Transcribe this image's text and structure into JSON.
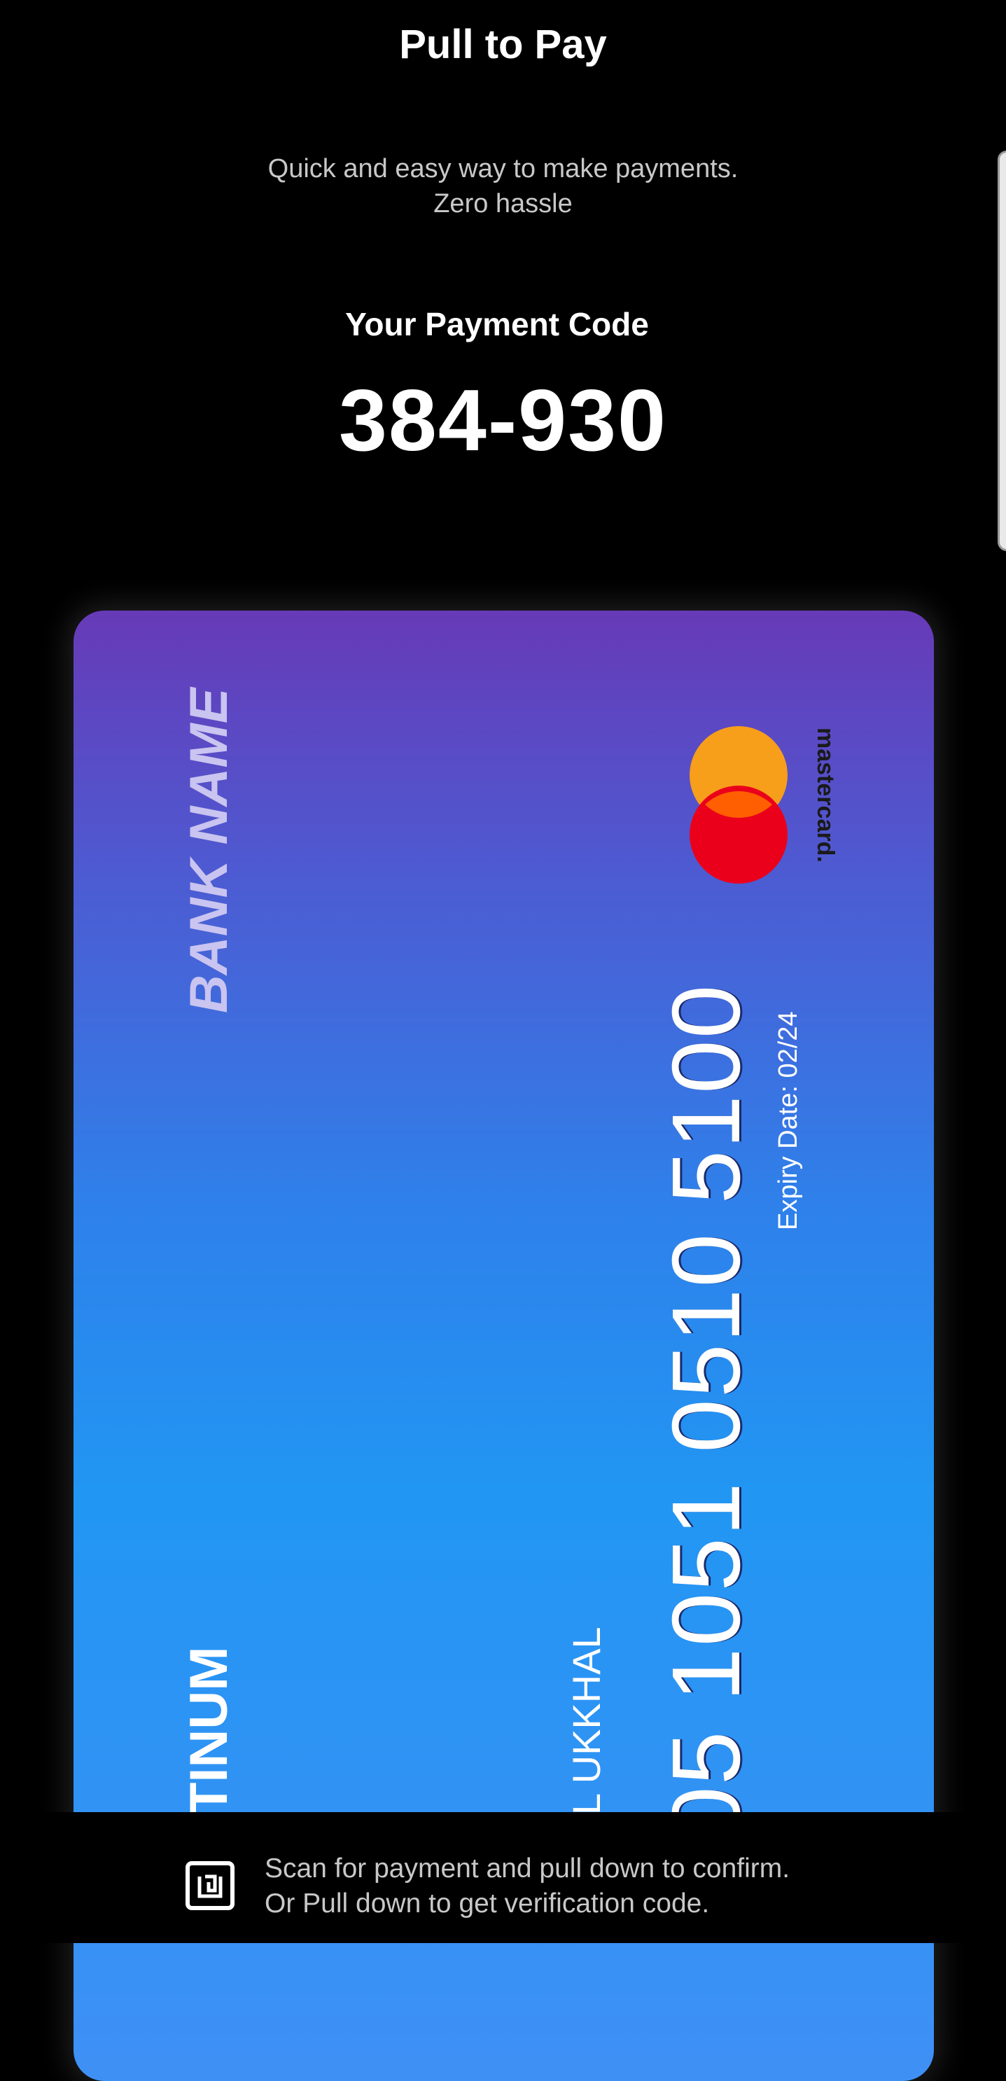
{
  "header": {
    "title": "Pull to Pay",
    "subtitle_line1": "Quick and easy way to make payments.",
    "subtitle_line2": "Zero hassle"
  },
  "payment_code": {
    "label": "Your Payment Code",
    "value": "384-930"
  },
  "card": {
    "bank_name": "BANK NAME",
    "tier": "TINUM",
    "holder": "L UKKHAL",
    "number": "05 1051 0510 5100",
    "expiry": "Expiry Date: 02/24",
    "network": "mastercard.",
    "gradient_top": "#673ab7",
    "gradient_bottom": "#2196f3"
  },
  "footer": {
    "hint_line1": "Scan for payment and pull down to confirm.",
    "hint_line2": "Or Pull down to get verification code.",
    "icon": "nfc-icon"
  }
}
